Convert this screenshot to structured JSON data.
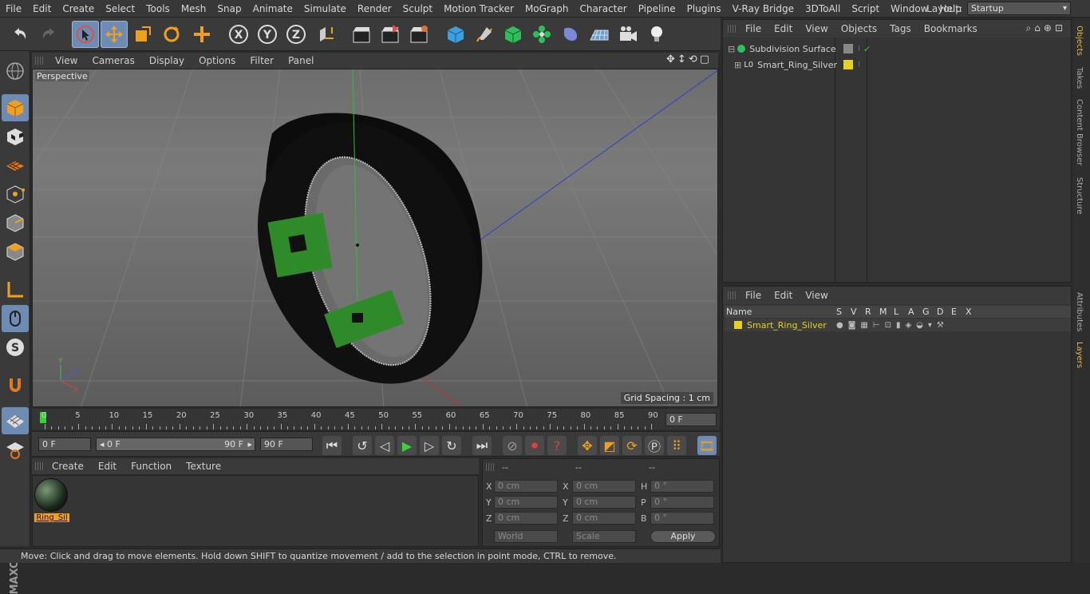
{
  "menubar": {
    "items": [
      "File",
      "Edit",
      "Create",
      "Select",
      "Tools",
      "Mesh",
      "Snap",
      "Animate",
      "Simulate",
      "Render",
      "Sculpt",
      "Motion Tracker",
      "MoGraph",
      "Character",
      "Pipeline",
      "Plugins",
      "V-Ray Bridge",
      "3DToAll",
      "Script",
      "Window",
      "Help"
    ],
    "layout_label": "Layout:",
    "layout_value": "Startup"
  },
  "toolbar": {
    "axis_x": "X",
    "axis_y": "Y",
    "axis_z": "Z"
  },
  "viewport": {
    "menu": [
      "View",
      "Cameras",
      "Display",
      "Options",
      "Filter",
      "Panel"
    ],
    "label": "Perspective",
    "grid_spacing": "Grid Spacing : 1 cm",
    "axis_x": "X",
    "axis_y": "Y",
    "axis_z": "Z"
  },
  "timeline": {
    "ticks": [
      "0",
      "5",
      "10",
      "15",
      "20",
      "25",
      "30",
      "35",
      "40",
      "45",
      "50",
      "55",
      "60",
      "65",
      "70",
      "75",
      "80",
      "85",
      "90"
    ],
    "current_frame": "0 F"
  },
  "transport": {
    "start_frame": "0 F",
    "range_start": "0 F",
    "range_end": "90 F",
    "end_frame": "90 F",
    "scale_range_left": "◂",
    "scale_range_right": "▸"
  },
  "materials": {
    "menu": [
      "Create",
      "Edit",
      "Function",
      "Texture"
    ],
    "material_name": "Ring_Sil"
  },
  "coordinates": {
    "headers": [
      "--",
      "--",
      "--"
    ],
    "pos": {
      "label_x": "X",
      "label_y": "Y",
      "label_z": "Z",
      "x": "0 cm",
      "y": "0 cm",
      "z": "0 cm"
    },
    "size": {
      "label_x": "X",
      "label_y": "Y",
      "label_z": "Z",
      "x": "0 cm",
      "y": "0 cm",
      "z": "0 cm"
    },
    "rot": {
      "label_h": "H",
      "label_p": "P",
      "label_b": "B",
      "h": "0 °",
      "p": "0 °",
      "b": "0 °"
    },
    "mode_world": "World",
    "mode_scale": "Scale",
    "apply": "Apply"
  },
  "status": {
    "text": "Move: Click and drag to move elements. Hold down SHIFT to quantize movement / add to the selection in point mode, CTRL to remove."
  },
  "objects": {
    "menu": [
      "File",
      "Edit",
      "View",
      "Objects",
      "Tags",
      "Bookmarks"
    ],
    "items": [
      {
        "name": "Subdivision Surface",
        "check": "✓"
      },
      {
        "name": "Smart_Ring_Silver",
        "prefix": "L0"
      }
    ]
  },
  "layers": {
    "menu": [
      "File",
      "Edit",
      "View"
    ],
    "columns": [
      "Name",
      "S",
      "V",
      "R",
      "M",
      "L",
      "A",
      "G",
      "D",
      "E",
      "X"
    ],
    "items": [
      {
        "name": "Smart_Ring_Silver",
        "color": "#e6d21e"
      }
    ]
  },
  "sidetabs": [
    "Objects",
    "Takes",
    "Content Browser",
    "Structure",
    "Attributes",
    "Layers"
  ],
  "colors": {
    "accent": "#6e8bb3",
    "layer_yellow": "#e6d21e",
    "active_tab": "#e8b84a"
  }
}
